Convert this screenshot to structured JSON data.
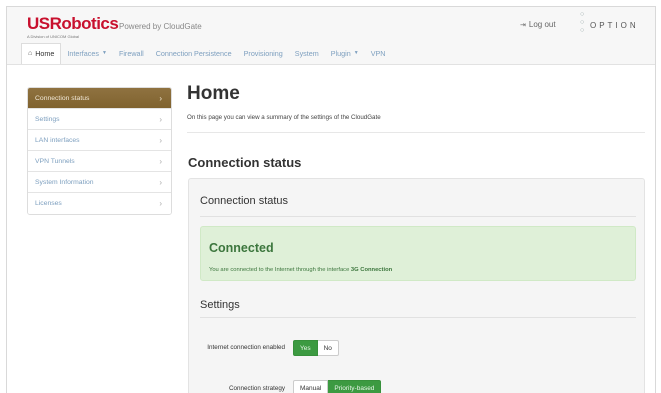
{
  "header": {
    "brand": "USRobotics",
    "brand_sub": "A Division of UNICOM Global",
    "powered_by": "Powered by CloudGate",
    "logout_label": "Log out",
    "option_logo": "OPTION"
  },
  "nav": {
    "items": [
      {
        "label": "Home",
        "active": true,
        "icon": "home-icon"
      },
      {
        "label": "Interfaces",
        "dropdown": true
      },
      {
        "label": "Firewall"
      },
      {
        "label": "Connection Persistence"
      },
      {
        "label": "Provisioning"
      },
      {
        "label": "System"
      },
      {
        "label": "Plugin",
        "dropdown": true
      },
      {
        "label": "VPN"
      }
    ]
  },
  "sidebar": {
    "items": [
      {
        "label": "Connection status",
        "active": true
      },
      {
        "label": "Settings"
      },
      {
        "label": "LAN interfaces"
      },
      {
        "label": "VPN Tunnels"
      },
      {
        "label": "System Information"
      },
      {
        "label": "Licenses"
      }
    ]
  },
  "main": {
    "title": "Home",
    "description": "On this page you can view a summary of the settings of the CloudGate",
    "section_title": "Connection status",
    "panel": {
      "title": "Connection status",
      "alert": {
        "status": "Connected",
        "text_prefix": "You are connected to the Internet through the interface ",
        "interface": "3G Connection"
      },
      "settings_title": "Settings",
      "internet_enabled": {
        "label": "Internet connection enabled",
        "options": [
          "Yes",
          "No"
        ],
        "selected": "Yes"
      },
      "strategy": {
        "label": "Connection strategy",
        "options": [
          "Manual",
          "Priority-based"
        ],
        "selected": "Priority-based"
      }
    }
  },
  "colors": {
    "brand_red": "#c8102e",
    "sidebar_active": "#8a6d3b",
    "link_blue": "#7d9fbf",
    "success_bg": "#dff0d8",
    "success_text": "#3c763d",
    "toggle_on": "#3c9a41"
  }
}
